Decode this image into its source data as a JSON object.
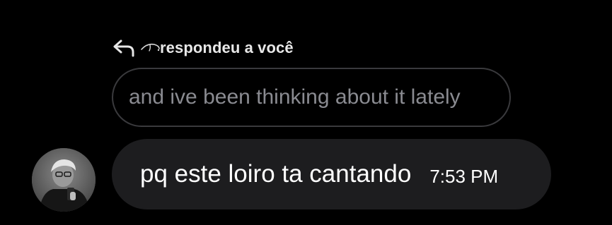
{
  "reply_header": {
    "text": "respondeu a você",
    "icon": "reply-arrow-icon",
    "nickname_icon": "curl-nickname-icon"
  },
  "quoted_message": {
    "text": "and ive been thinking about it lately"
  },
  "message": {
    "avatar": "user-avatar",
    "text": "pq este loiro ta cantando",
    "time": "7:53 PM"
  },
  "colors": {
    "background": "#000000",
    "bubble": "#1d1d1f",
    "quoted_border": "#3a3a3d",
    "quoted_text": "#8a8b91",
    "text": "#ffffff"
  }
}
